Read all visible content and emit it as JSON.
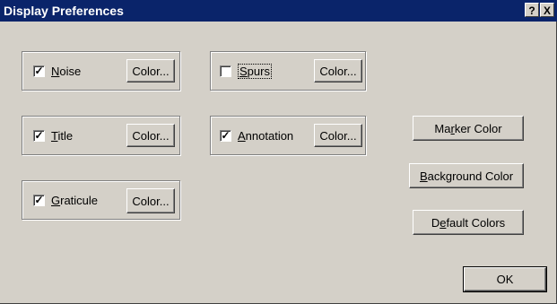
{
  "dialog": {
    "title": "Display Preferences",
    "help_label": "?",
    "close_label": "X"
  },
  "checks": {
    "noise": {
      "pre": "",
      "mnemonic": "N",
      "post": "oise",
      "checked": true,
      "color_label": "Color..."
    },
    "spurs": {
      "pre": "",
      "mnemonic": "S",
      "post": "purs",
      "checked": false,
      "color_label": "Color..."
    },
    "title": {
      "pre": "",
      "mnemonic": "T",
      "post": "itle",
      "checked": true,
      "color_label": "Color..."
    },
    "annotation": {
      "pre": "",
      "mnemonic": "A",
      "post": "nnotation",
      "checked": true,
      "color_label": "Color..."
    },
    "graticule": {
      "pre": "",
      "mnemonic": "G",
      "post": "raticule",
      "checked": true,
      "color_label": "Color..."
    }
  },
  "buttons": {
    "marker": {
      "pre": "Ma",
      "mnemonic": "r",
      "post": "ker Color"
    },
    "background": {
      "pre": "",
      "mnemonic": "B",
      "post": "ackground Color"
    },
    "default": {
      "pre": "D",
      "mnemonic": "e",
      "post": "fault Colors"
    },
    "ok": {
      "label": "OK"
    }
  },
  "check_mark": "✓"
}
